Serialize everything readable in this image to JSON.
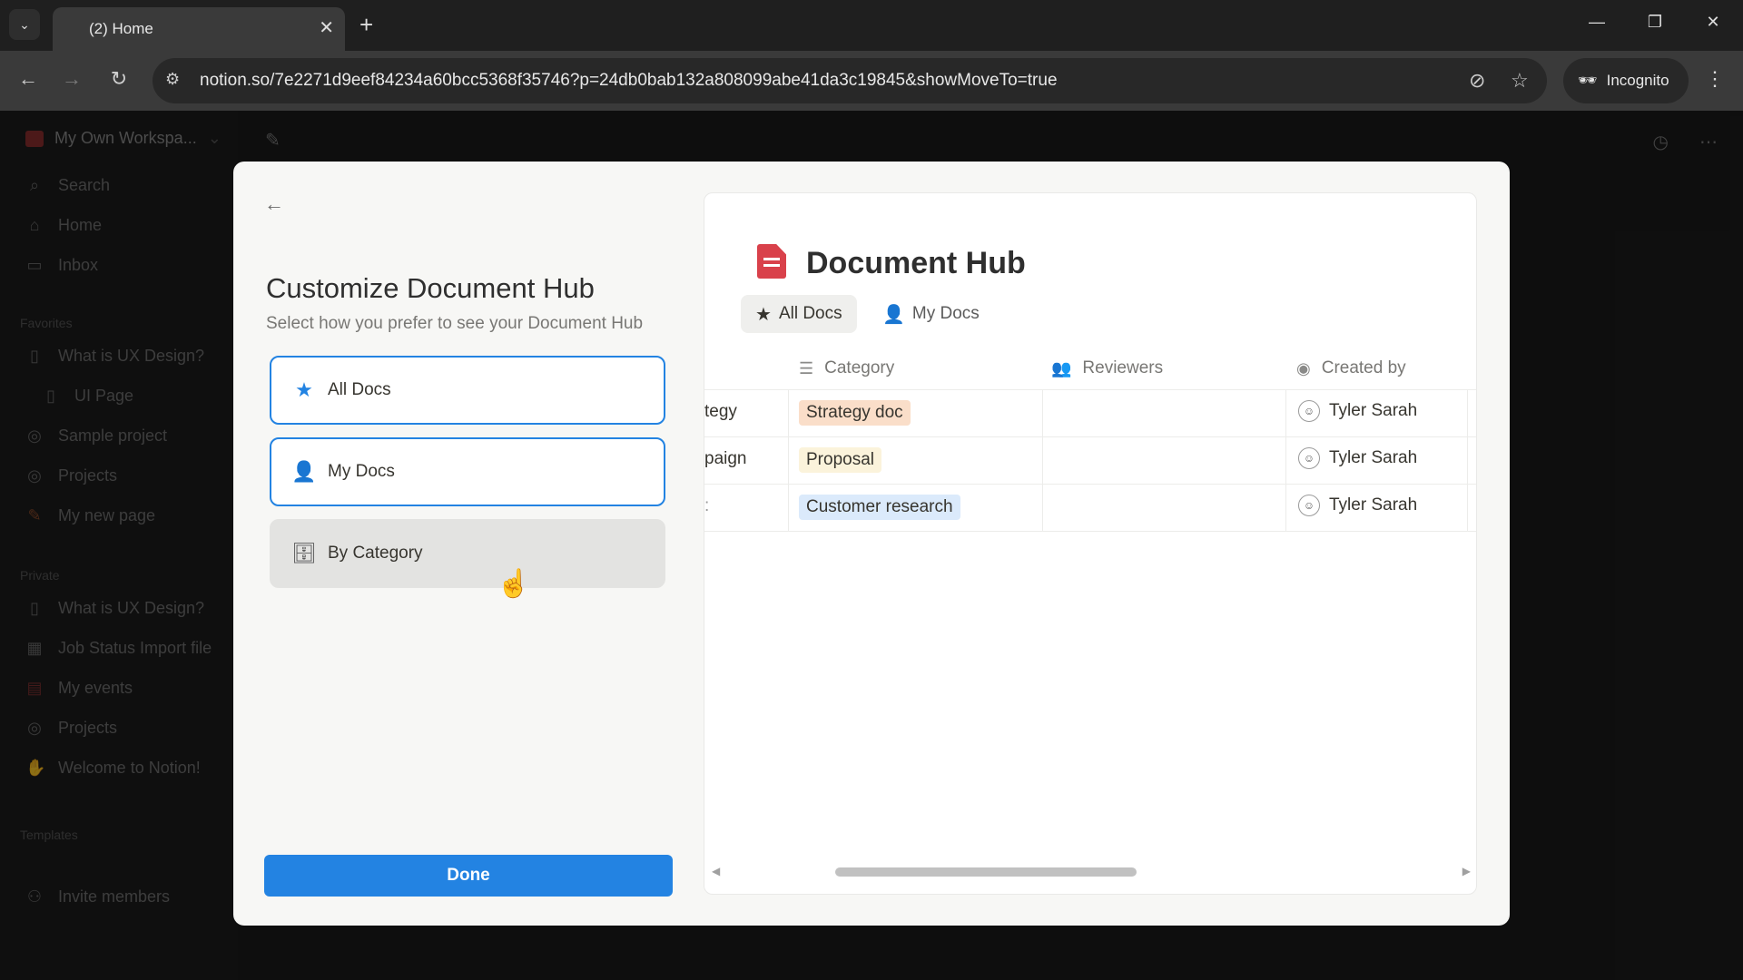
{
  "browser": {
    "tab_title": "(2) Home",
    "url": "notion.so/7e2271d9eef84234a60bcc5368f35746?p=24db0bab132a808099abe41da3c19845&showMoveTo=true",
    "incognito_label": "Incognito"
  },
  "sidebar": {
    "workspace": "My Own Workspa...",
    "items_top": [
      {
        "label": "Search",
        "icon": "search-icon"
      },
      {
        "label": "Home",
        "icon": "home-icon"
      },
      {
        "label": "Inbox",
        "icon": "inbox-icon"
      }
    ],
    "favorites_header": "Favorites",
    "favorites": [
      {
        "label": "What is UX Design?",
        "icon": "page-icon"
      },
      {
        "label": "UI Page",
        "icon": "page-icon"
      },
      {
        "label": "Sample project",
        "icon": "target-icon"
      },
      {
        "label": "Projects",
        "icon": "target-icon"
      },
      {
        "label": "My new page",
        "icon": "pencil-icon"
      }
    ],
    "private_header": "Private",
    "private": [
      {
        "label": "What is UX Design?",
        "icon": "page-icon"
      },
      {
        "label": "Job Status Import file",
        "icon": "table-icon"
      },
      {
        "label": "My events",
        "icon": "calendar-icon"
      },
      {
        "label": "Projects",
        "icon": "target-icon"
      },
      {
        "label": "Welcome to Notion!",
        "icon": "wave-icon"
      }
    ],
    "templates_header": "Templates",
    "invite": "Invite members"
  },
  "modal": {
    "title": "Customize Document Hub",
    "subtitle": "Select how you prefer to see your Document Hub",
    "options": [
      {
        "label": "All Docs",
        "icon": "star-icon",
        "selected": true
      },
      {
        "label": "My Docs",
        "icon": "person-icon",
        "selected": true
      },
      {
        "label": "By Category",
        "icon": "archive-icon",
        "selected": false
      }
    ],
    "done_label": "Done"
  },
  "preview": {
    "title": "Document Hub",
    "tabs": [
      {
        "label": "All Docs",
        "icon": "star-icon",
        "active": true
      },
      {
        "label": "My Docs",
        "icon": "person-icon",
        "active": false
      }
    ],
    "columns": [
      {
        "label": "Category",
        "icon": "list-icon"
      },
      {
        "label": "Reviewers",
        "icon": "people-icon"
      },
      {
        "label": "Created by",
        "icon": "user-circle-icon"
      }
    ],
    "rows": [
      {
        "name": "tegy",
        "category": "Strategy doc",
        "category_color": "#fadec9",
        "created_by": "Tyler Sarah"
      },
      {
        "name": "paign",
        "category": "Proposal",
        "category_color": "#fbf3db",
        "created_by": "Tyler Sarah"
      },
      {
        "name": ":",
        "category": "Customer research",
        "category_color": "#dbeafb",
        "created_by": "Tyler Sarah"
      }
    ]
  }
}
